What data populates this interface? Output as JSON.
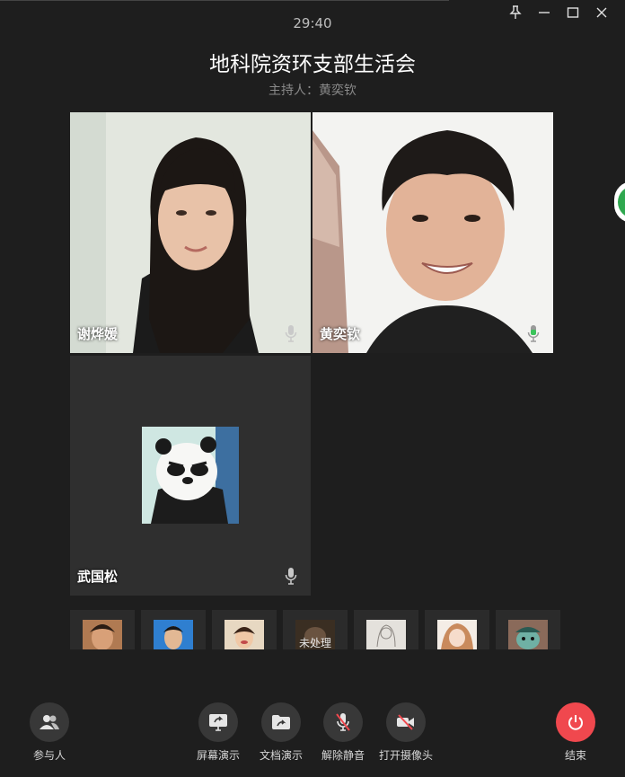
{
  "meeting": {
    "timer": "29:40",
    "title": "地科院资环支部生活会",
    "host": "主持人：黄奕钦"
  },
  "participants": [
    {
      "name": "谢烨媛",
      "mic": "muted-gray"
    },
    {
      "name": "黄奕钦",
      "mic": "active-green"
    },
    {
      "name": "武国松",
      "mic": "muted-gray"
    }
  ],
  "thumbnails": [
    {
      "icon": "portrait-avatar-icon",
      "label": ""
    },
    {
      "icon": "portrait-avatar-icon",
      "label": ""
    },
    {
      "icon": "portrait-avatar-icon",
      "label": ""
    },
    {
      "icon": "portrait-avatar-icon",
      "label": "未处理"
    },
    {
      "icon": "sketch-avatar-icon",
      "label": ""
    },
    {
      "icon": "anime-avatar-icon",
      "label": ""
    },
    {
      "icon": "cartoon-avatar-icon",
      "label": ""
    }
  ],
  "toolbar": {
    "participants": "参与人",
    "screen_share": "屏幕演示",
    "doc_share": "文档演示",
    "unmute": "解除静音",
    "camera": "打开摄像头",
    "end": "结束"
  },
  "colors": {
    "background": "#1e1e1e",
    "button_bg": "#383838",
    "end_button": "#f0484e",
    "mic_active": "#3bc45a"
  }
}
